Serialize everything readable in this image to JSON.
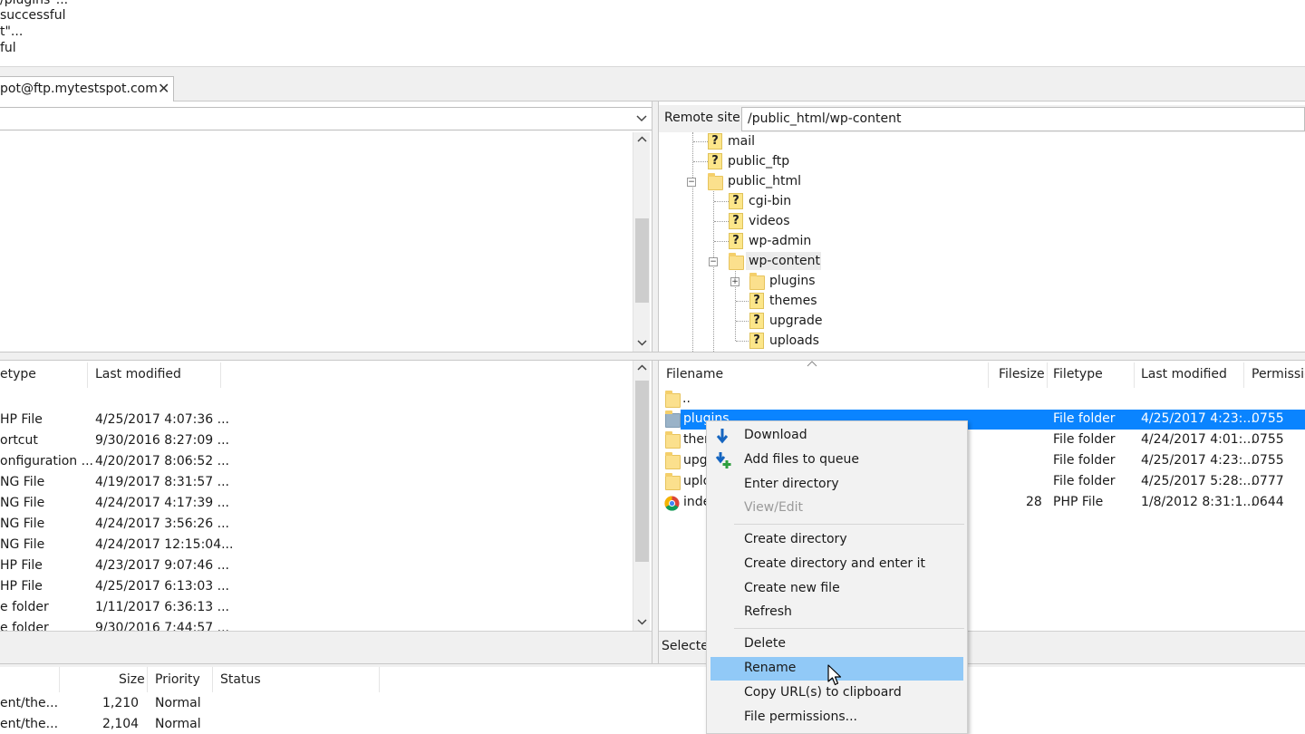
{
  "log": {
    "lines": [
      "/plugins\"...",
      "successful",
      "t\"...",
      "ful"
    ]
  },
  "tab": {
    "label": "pot@ftp.mytestspot.com",
    "close_glyph": "✕"
  },
  "remote": {
    "site_label": "Remote site:",
    "path": "/public_html/wp-content",
    "tree": [
      {
        "name": "mail",
        "icon": "question-folder-icon"
      },
      {
        "name": "public_ftp",
        "icon": "question-folder-icon"
      },
      {
        "name": "public_html",
        "icon": "folder-icon",
        "expanded": true
      },
      {
        "name": "cgi-bin",
        "icon": "question-folder-icon"
      },
      {
        "name": "videos",
        "icon": "question-folder-icon"
      },
      {
        "name": "wp-admin",
        "icon": "question-folder-icon"
      },
      {
        "name": "wp-content",
        "icon": "folder-icon",
        "expanded": true,
        "selected": true
      },
      {
        "name": "plugins",
        "icon": "folder-icon",
        "collapsed": true
      },
      {
        "name": "themes",
        "icon": "question-folder-icon"
      },
      {
        "name": "upgrade",
        "icon": "question-folder-icon"
      },
      {
        "name": "uploads",
        "icon": "question-folder-icon"
      }
    ],
    "headers": {
      "filename": "Filename",
      "filesize": "Filesize",
      "filetype": "Filetype",
      "last_modified": "Last modified",
      "permissions": "Permissio"
    },
    "files": [
      {
        "name": "..",
        "size": "",
        "type": "",
        "modified": "",
        "perms": ""
      },
      {
        "name": "plugins",
        "size": "",
        "type": "File folder",
        "modified": "4/25/2017 4:23:...",
        "perms": "0755"
      },
      {
        "name": "ther",
        "size": "",
        "type": "File folder",
        "modified": "4/24/2017 4:01:...",
        "perms": "0755"
      },
      {
        "name": "upg",
        "size": "",
        "type": "File folder",
        "modified": "4/25/2017 4:23:...",
        "perms": "0755"
      },
      {
        "name": "uplo",
        "size": "",
        "type": "File folder",
        "modified": "4/25/2017 5:28:...",
        "perms": "0777"
      },
      {
        "name": "inde",
        "size": "28",
        "type": "PHP File",
        "modified": "1/8/2012 8:31:1...",
        "perms": "0644"
      }
    ],
    "status": "Selecte"
  },
  "local": {
    "headers": {
      "filetype": "etype",
      "last_modified": "Last modified"
    },
    "files": [
      {
        "type": "HP File",
        "modified": "4/25/2017 4:07:36 ..."
      },
      {
        "type": "ortcut",
        "modified": "9/30/2016 8:27:09 ..."
      },
      {
        "type": "onfiguration ...",
        "modified": "4/20/2017 8:06:52 ..."
      },
      {
        "type": "NG File",
        "modified": "4/19/2017 8:31:57 ..."
      },
      {
        "type": "NG File",
        "modified": "4/24/2017 4:17:39 ..."
      },
      {
        "type": "NG File",
        "modified": "4/24/2017 3:56:26 ..."
      },
      {
        "type": "NG File",
        "modified": "4/24/2017 12:15:04..."
      },
      {
        "type": "HP File",
        "modified": "4/23/2017 9:07:46 ..."
      },
      {
        "type": "HP File",
        "modified": "4/25/2017 6:13:03 ..."
      },
      {
        "type": "e folder",
        "modified": "1/11/2017 6:36:13 ..."
      },
      {
        "type": "e folder",
        "modified": "9/30/2016 7:44:57 ..."
      }
    ]
  },
  "queue": {
    "headers": {
      "size": "Size",
      "priority": "Priority",
      "status": "Status"
    },
    "rows": [
      {
        "file": "ent/the...",
        "size": "1,210",
        "priority": "Normal"
      },
      {
        "file": "ent/the...",
        "size": "2,104",
        "priority": "Normal"
      }
    ]
  },
  "context_menu": {
    "items": [
      {
        "label": "Download",
        "icon": "download-arrow-icon"
      },
      {
        "label": "Add files to queue",
        "icon": "add-to-queue-icon"
      },
      {
        "label": "Enter directory"
      },
      {
        "label": "View/Edit",
        "disabled": true
      },
      {
        "label": "Create directory"
      },
      {
        "label": "Create directory and enter it"
      },
      {
        "label": "Create new file"
      },
      {
        "label": "Refresh"
      },
      {
        "label": "Delete"
      },
      {
        "label": "Rename",
        "hover": true
      },
      {
        "label": "Copy URL(s) to clipboard"
      },
      {
        "label": "File permissions..."
      }
    ]
  },
  "colors": {
    "selection": "#0a84ff",
    "menu_hover": "#91c9f7",
    "folder": "#fbe08d"
  }
}
